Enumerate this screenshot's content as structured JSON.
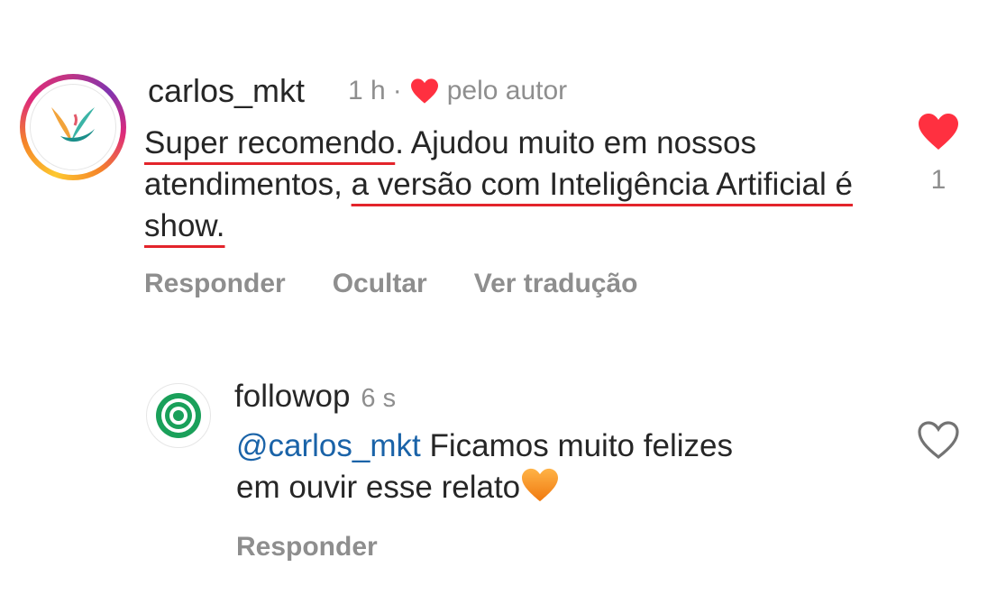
{
  "comment": {
    "username": "carlos_mkt",
    "time": "1 h",
    "separator": "·",
    "liked_by_author_label": "pelo autor",
    "text_part1": "Super recomendo",
    "text_part2": ". Ajudou muito em nossos atendimentos, ",
    "text_part3": "a versão com Inteligência Artificial é show.",
    "like_count": "1",
    "actions": [
      "Responder",
      "Ocultar",
      "Ver tradução"
    ],
    "liked": true
  },
  "reply": {
    "username": "followop",
    "time": "6 s",
    "mention": "@carlos_mkt",
    "text": " Ficamos muito felizes em ouvir esse relato",
    "emoji": "orange-heart",
    "actions": [
      "Responder"
    ],
    "liked": false
  },
  "colors": {
    "like_red": "#ff3040",
    "underline_red": "#e3242b",
    "mention_blue": "#1a63a8",
    "muted_gray": "#8e8e8e",
    "followop_green": "#1aa05a"
  }
}
